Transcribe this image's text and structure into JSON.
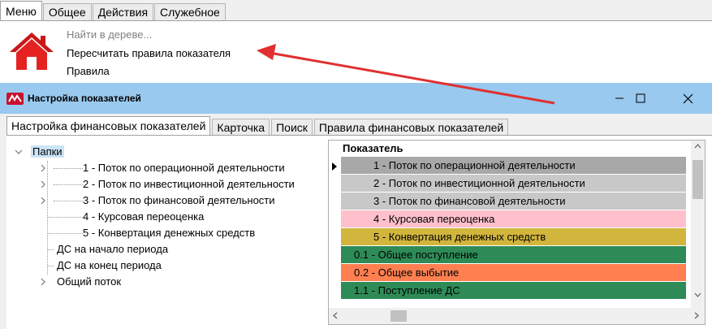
{
  "top_tabs": [
    "Меню",
    "Общее",
    "Действия",
    "Служебное"
  ],
  "ribbon": {
    "search_label": "Найти в дереве...",
    "recalc_label": "Пересчитать правила показателя",
    "rules_label": "Правила"
  },
  "dialog": {
    "title": "Настройка показателей",
    "tabs": [
      "Настройка финансовых показателей",
      "Карточка",
      "Поиск",
      "Правила финансовых показателей"
    ]
  },
  "tree": {
    "root": "Папки",
    "items": [
      "1 - Поток по операционной деятельности",
      "2 - Поток по инвестиционной деятельности",
      "3 - Поток по финансовой деятельности",
      "4 - Курсовая переоценка",
      "5 - Конвертация денежных средств",
      "ДС на начало периода",
      "ДС на конец периода",
      "Общий поток"
    ]
  },
  "grid": {
    "header": "Показатель",
    "rows": [
      {
        "label": "1 - Поток по операционной деятельности",
        "color": "#a8a8a8"
      },
      {
        "label": "2 - Поток по инвестиционной деятельности",
        "color": "#c8c8c8"
      },
      {
        "label": "3 - Поток по финансовой деятельности",
        "color": "#c8c8c8"
      },
      {
        "label": "4 - Курсовая переоценка",
        "color": "#ffc0cb"
      },
      {
        "label": "5 - Конвертация денежных средств",
        "color": "#d2b53c"
      },
      {
        "label": "0.1 - Общее поступление",
        "color": "#2e8b57"
      },
      {
        "label": "0.2 - Общее выбытие",
        "color": "#ff7f50"
      },
      {
        "label": "1.1 - Поступление ДС",
        "color": "#2e8b57"
      }
    ]
  },
  "colors": {
    "titlebar": "#99c9ef",
    "arrow": "#e03030",
    "home_icon": "#e02020"
  }
}
